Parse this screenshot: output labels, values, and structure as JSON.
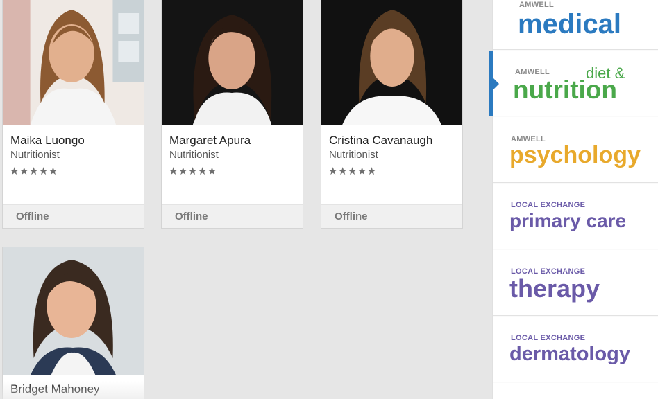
{
  "providers": [
    {
      "name": "Maika Luongo",
      "role": "Nutritionist",
      "rating": "★★★★★",
      "status": "Offline"
    },
    {
      "name": "Margaret Apura",
      "role": "Nutritionist",
      "rating": "★★★★★",
      "status": "Offline"
    },
    {
      "name": "Cristina Cavanaugh",
      "role": "Nutritionist",
      "rating": "★★★★★",
      "status": "Offline"
    },
    {
      "name": "Bridget Mahoney"
    }
  ],
  "services": [
    {
      "small": "AMWELL",
      "big": "medical",
      "color": "#2b7ac0"
    },
    {
      "small": "AMWELL",
      "extra": "diet &",
      "big": "nutrition",
      "color": "#4aa84a"
    },
    {
      "small": "AMWELL",
      "big": "psychology",
      "color": "#e8a92c"
    },
    {
      "small": "LOCAL EXCHANGE",
      "big": "primary care",
      "color": "#6a5aa8"
    },
    {
      "small": "LOCAL EXCHANGE",
      "big": "therapy",
      "color": "#6a5aa8"
    },
    {
      "small": "LOCAL EXCHANGE",
      "big": "dermatology",
      "color": "#6a5aa8"
    }
  ],
  "colors": {
    "background": "#e6e6e6",
    "active_indicator": "#2b7ac0"
  }
}
